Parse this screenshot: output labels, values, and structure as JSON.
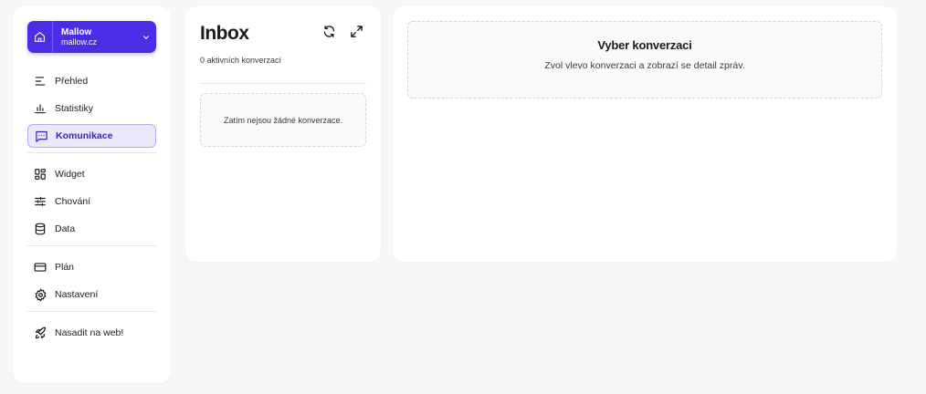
{
  "sidebar": {
    "site": {
      "name": "Mallow",
      "domain": "mallow.cz",
      "icon": "home-icon"
    },
    "groups": [
      [
        {
          "id": "prehled",
          "label": "Přehled",
          "icon": "overview-icon"
        },
        {
          "id": "statistiky",
          "label": "Statistiky",
          "icon": "bar-chart-icon"
        },
        {
          "id": "komunikace",
          "label": "Komunikace",
          "icon": "chat-icon",
          "active": true
        }
      ],
      [
        {
          "id": "widget",
          "label": "Widget",
          "icon": "dashboard-icon"
        },
        {
          "id": "chovani",
          "label": "Chování",
          "icon": "sliders-icon"
        },
        {
          "id": "data",
          "label": "Data",
          "icon": "database-icon"
        }
      ],
      [
        {
          "id": "plan",
          "label": "Plán",
          "icon": "credit-card-icon"
        },
        {
          "id": "nastaveni",
          "label": "Nastavení",
          "icon": "gear-icon"
        }
      ],
      [
        {
          "id": "nasadit",
          "label": "Nasadit na web!",
          "icon": "rocket-icon"
        }
      ]
    ]
  },
  "inbox": {
    "title": "Inbox",
    "subtitle": "0 aktivních konverzací",
    "empty": "Zatím nejsou žádné konverzace."
  },
  "detail": {
    "title": "Vyber konverzaci",
    "description": "Zvol vlevo konverzaci a zobrazí se detail zpráv."
  },
  "colors": {
    "accent": "#4a2ee6",
    "active_bg": "#ebe7fc",
    "active_border": "#b7abf3",
    "background": "#f7f7f9"
  }
}
